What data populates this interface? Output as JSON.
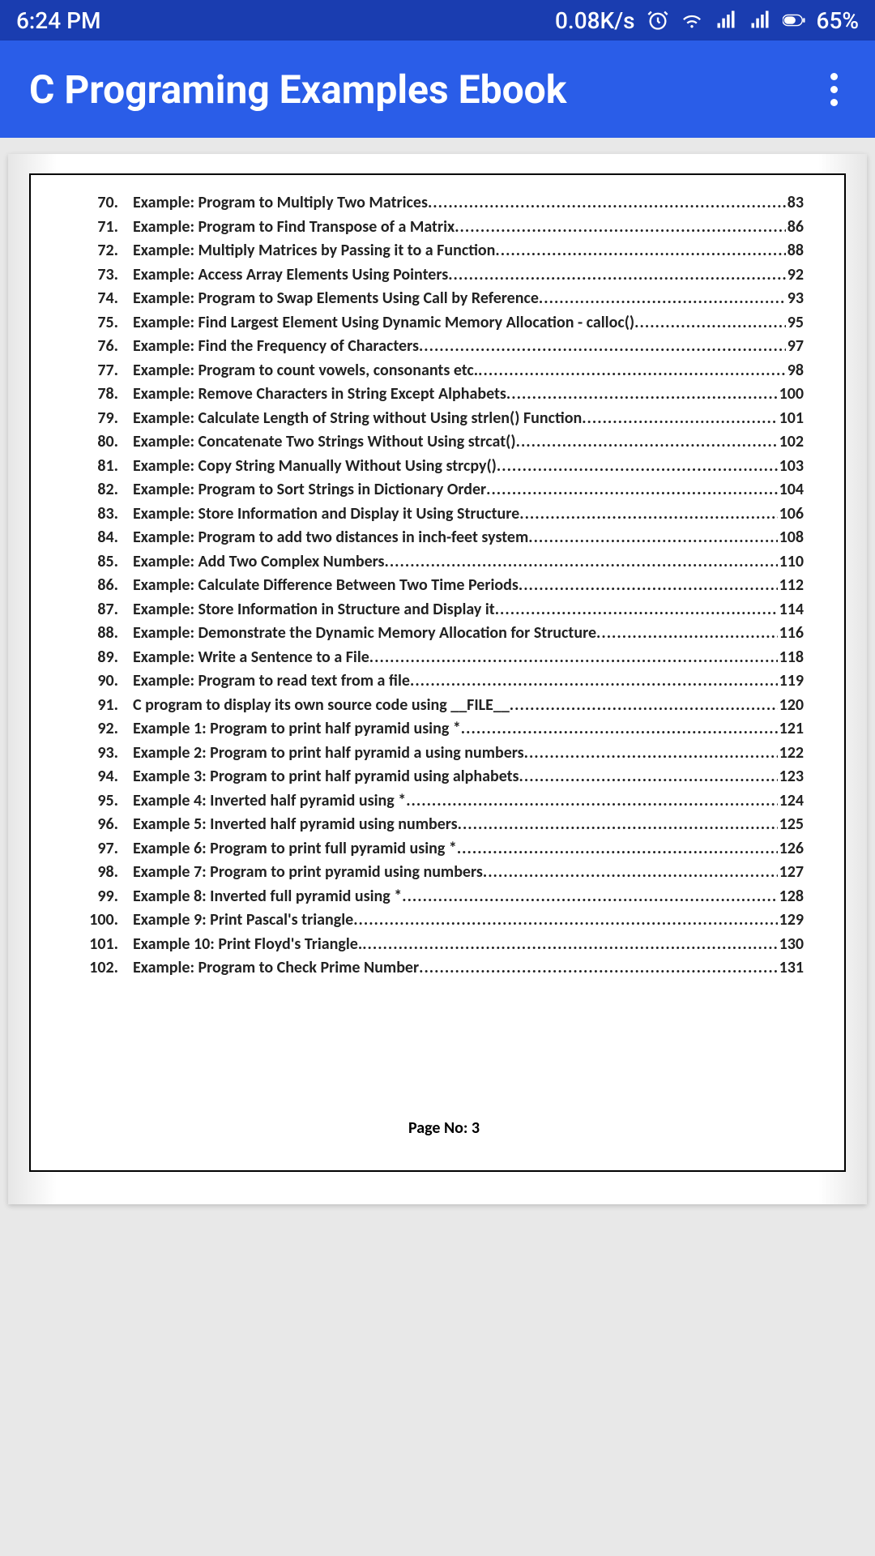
{
  "status": {
    "time": "6:24 PM",
    "net_speed": "0.08K/s",
    "battery": "65%"
  },
  "appbar": {
    "title": "C Programing Examples Ebook"
  },
  "toc": [
    {
      "n": "70.",
      "t": "Example: Program to Multiply Two Matrices",
      "p": "83"
    },
    {
      "n": "71.",
      "t": "Example: Program to Find Transpose of a Matrix",
      "p": "86"
    },
    {
      "n": "72.",
      "t": "Example: Multiply Matrices by Passing it to a Function",
      "p": "88"
    },
    {
      "n": "73.",
      "t": "Example: Access Array Elements Using Pointers",
      "p": "92"
    },
    {
      "n": "74.",
      "t": "Example: Program to Swap Elements Using Call by Reference",
      "p": "93"
    },
    {
      "n": "75.",
      "t": "Example: Find Largest Element Using Dynamic Memory Allocation - calloc()",
      "p": "95"
    },
    {
      "n": "76.",
      "t": "Example: Find the Frequency of Characters",
      "p": "97"
    },
    {
      "n": "77.",
      "t": "Example: Program to count vowels, consonants etc.",
      "p": "98"
    },
    {
      "n": "78.",
      "t": "Example: Remove Characters in String Except Alphabets",
      "p": "100"
    },
    {
      "n": "79.",
      "t": "Example: Calculate Length of String without Using strlen() Function",
      "p": "101"
    },
    {
      "n": "80.",
      "t": "Example: Concatenate Two Strings Without Using strcat() ",
      "p": "102"
    },
    {
      "n": "81.",
      "t": "Example: Copy String Manually Without Using strcpy()",
      "p": "103"
    },
    {
      "n": "82.",
      "t": "Example: Program to Sort Strings in Dictionary Order",
      "p": "104"
    },
    {
      "n": "83.",
      "t": "Example: Store Information and Display it Using Structure",
      "p": "106"
    },
    {
      "n": "84.",
      "t": "Example: Program to add two distances in inch-feet system ",
      "p": "108"
    },
    {
      "n": "85.",
      "t": "Example: Add Two Complex Numbers ",
      "p": "110"
    },
    {
      "n": "86.",
      "t": "Example: Calculate Difference Between Two Time Periods",
      "p": "112"
    },
    {
      "n": "87.",
      "t": "Example: Store Information in Structure and Display it",
      "p": "114"
    },
    {
      "n": "88.",
      "t": "Example: Demonstrate the Dynamic Memory Allocation for Structure ",
      "p": "116"
    },
    {
      "n": "89.",
      "t": "Example: Write a Sentence to a File",
      "p": "118"
    },
    {
      "n": "90.",
      "t": "Example: Program to read text from a file ",
      "p": "119"
    },
    {
      "n": "91.",
      "t": "C program to display its own source code using __FILE__",
      "p": "120"
    },
    {
      "n": "92.",
      "t": "Example 1: Program to print half pyramid using *",
      "p": "121"
    },
    {
      "n": "93.",
      "t": "Example 2: Program to print half pyramid a using numbers",
      "p": "122"
    },
    {
      "n": "94.",
      "t": "Example 3: Program to print half pyramid using alphabets",
      "p": "123"
    },
    {
      "n": "95.",
      "t": "Example 4: Inverted half pyramid using * ",
      "p": "124"
    },
    {
      "n": "96.",
      "t": "Example 5: Inverted half pyramid using numbers",
      "p": "125"
    },
    {
      "n": "97.",
      "t": "Example 6: Program to print full pyramid using *",
      "p": "126"
    },
    {
      "n": "98.",
      "t": "Example 7: Program to print pyramid using numbers",
      "p": "127"
    },
    {
      "n": "99.",
      "t": "Example 8: Inverted full pyramid using * ",
      "p": "128"
    },
    {
      "n": "100.",
      "t": "Example 9: Print Pascal's triangle ",
      "p": "129"
    },
    {
      "n": "101.",
      "t": "Example 10: Print Floyd's Triangle.",
      "p": "130"
    },
    {
      "n": "102.",
      "t": "Example: Program to Check Prime Number",
      "p": "131"
    }
  ],
  "footer": {
    "page_label": "Page No: 3"
  }
}
